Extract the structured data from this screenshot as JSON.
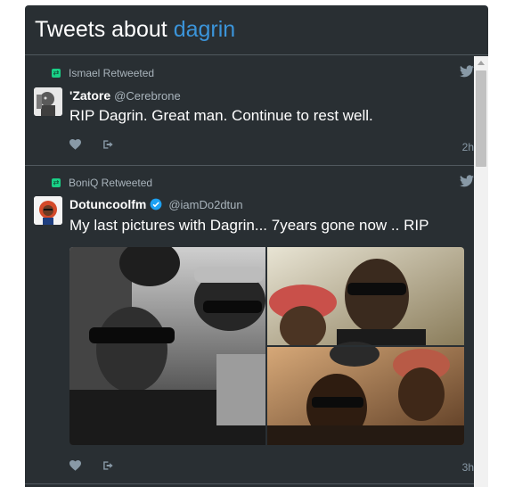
{
  "header": {
    "title_prefix": "Tweets about",
    "title_query": "dagrin"
  },
  "tweets": [
    {
      "retweeted_by": "Ismael Retweeted",
      "name": "'Zatore",
      "handle": "@Cerebrone",
      "text": "RIP Dagrin. Great man. Continue to rest well.",
      "time": "2h"
    },
    {
      "retweeted_by": "BoniQ Retweeted",
      "name": "Dotuncoolfm",
      "handle": "@iamDo2dtun",
      "text": "My last pictures with Dagrin... 7years gone now .. RIP",
      "time": "3h"
    }
  ],
  "colors": {
    "accent": "#3b94d9",
    "background": "#292f33",
    "retweet": "#19cf86",
    "verified": "#1da1f2"
  },
  "icons": [
    "retweet-icon",
    "twitter-bird-icon",
    "like-heart-icon",
    "share-icon",
    "verified-badge-icon"
  ]
}
